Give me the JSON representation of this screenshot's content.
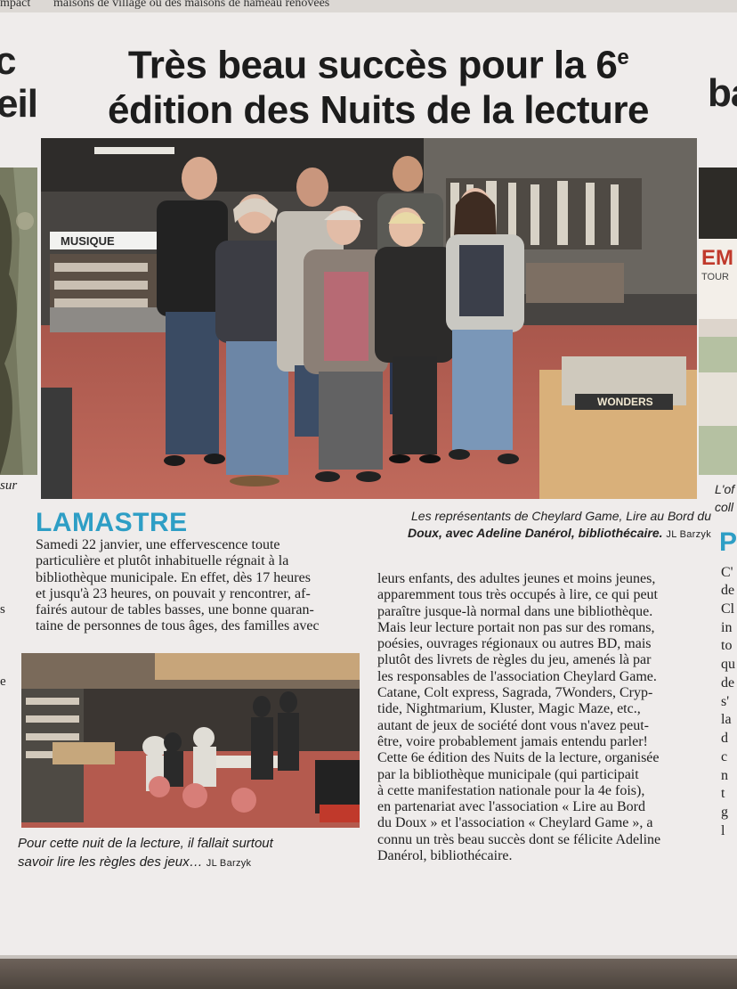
{
  "top_snippet_left": "mpact",
  "top_snippet_right": "maisons de village ou des maisons de hameau rénovées",
  "left_edge": {
    "c": "c",
    "eil": "eil",
    "sur": "sur",
    "s": "s",
    "e": "e"
  },
  "right_edge": {
    "ba": "ba",
    "em": "EM",
    "tour": "TOUR",
    "lof": "L'of",
    "coll": "coll",
    "p": "P",
    "letters": [
      "C'",
      "de",
      "Cl",
      "in",
      "to",
      "qu",
      "de",
      "s'",
      "la",
      "d",
      "c",
      "n",
      "t",
      "g",
      "l"
    ]
  },
  "headline": {
    "line1": "Très beau succès pour la 6",
    "sup": "e",
    "line2": "édition des Nuits de la lecture"
  },
  "photo1": {
    "sign": "MUSIQUE",
    "box_label": "WONDERS"
  },
  "town": "LAMASTRE",
  "caption1": {
    "line1": "Les représentants de Cheylard Game, Lire au Bord du",
    "line2_bold": "Doux, avec Adeline Danérol, bibliothécaire.",
    "credit": "JL Barzyk"
  },
  "col1_lines": [
    "Samedi 22 janvier, une effervescence toute",
    "particulière et plutôt inhabituelle régnait à la",
    "bibliothèque municipale. En effet, dès 17 heures",
    "et jusqu'à 23 heures, on pouvait y rencontrer, af-",
    "fairés autour de tables basses, une bonne quaran-",
    "taine de personnes de tous âges, des familles avec"
  ],
  "col2_lines": [
    "leurs enfants, des adultes jeunes et moins jeunes,",
    "apparemment tous très occupés à lire, ce qui peut",
    "paraître jusque-là normal dans une bibliothèque.",
    "Mais leur lecture portait non pas sur des romans,",
    "poésies, ouvrages régionaux ou autres BD, mais",
    "plutôt des livrets de règles du jeu, amenés là par",
    "les responsables de l'association Cheylard Game.",
    "Catane, Colt express, Sagrada, 7Wonders, Cryp-",
    "tide, Nightmarium, Kluster, Magic Maze, etc.,",
    "autant de jeux de société dont vous n'avez peut-",
    "être, voire probablement jamais entendu parler!",
    "Cette 6e édition des Nuits de la lecture, organisée",
    "par la bibliothèque municipale (qui participait",
    "à cette manifestation nationale pour la 4e fois),",
    "en partenariat avec l'association « Lire au Bord",
    "du Doux » et l'association « Cheylard Game », a",
    "connu un très beau succès dont se félicite Adeline",
    "Danérol, bibliothécaire."
  ],
  "caption2": {
    "line1": "Pour cette nuit de la lecture, il fallait surtout",
    "line2": "savoir lire les règles des jeux…",
    "credit": "JL Barzyk"
  }
}
